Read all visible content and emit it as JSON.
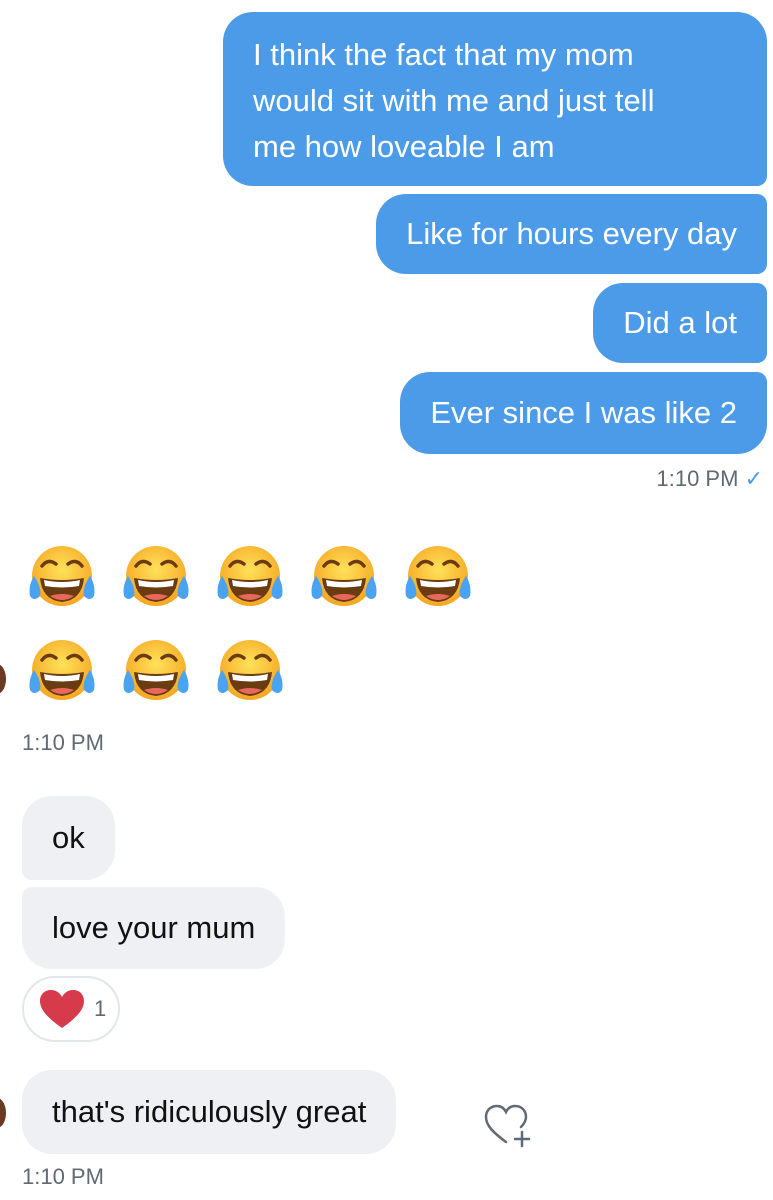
{
  "outgoing": {
    "messages": [
      [
        "I think the fact that my mom",
        "would sit with me and just tell",
        "me how loveable I am"
      ],
      [
        "Like for hours every day"
      ],
      [
        "Did a lot"
      ],
      [
        "Ever since I was like 2"
      ]
    ],
    "time": "1:10 PM",
    "status_icon": "check-icon",
    "status_glyph": "✓"
  },
  "incoming": {
    "emoji_message": {
      "emoji_name": "face-with-tears-of-joy",
      "row1_count": 5,
      "row2_count": 3,
      "time": "1:10 PM"
    },
    "messages": [
      {
        "text": "ok"
      },
      {
        "text": "love your mum"
      },
      {
        "text": "that's ridiculously great"
      }
    ],
    "reaction": {
      "icon": "heart-icon",
      "count": "1"
    },
    "time": "1:10 PM"
  },
  "colors": {
    "outgoing_bubble": "#4c9be8",
    "incoming_bubble": "#eef0f3",
    "heart": "#d73a4a",
    "timestamp": "#5f6a75"
  }
}
